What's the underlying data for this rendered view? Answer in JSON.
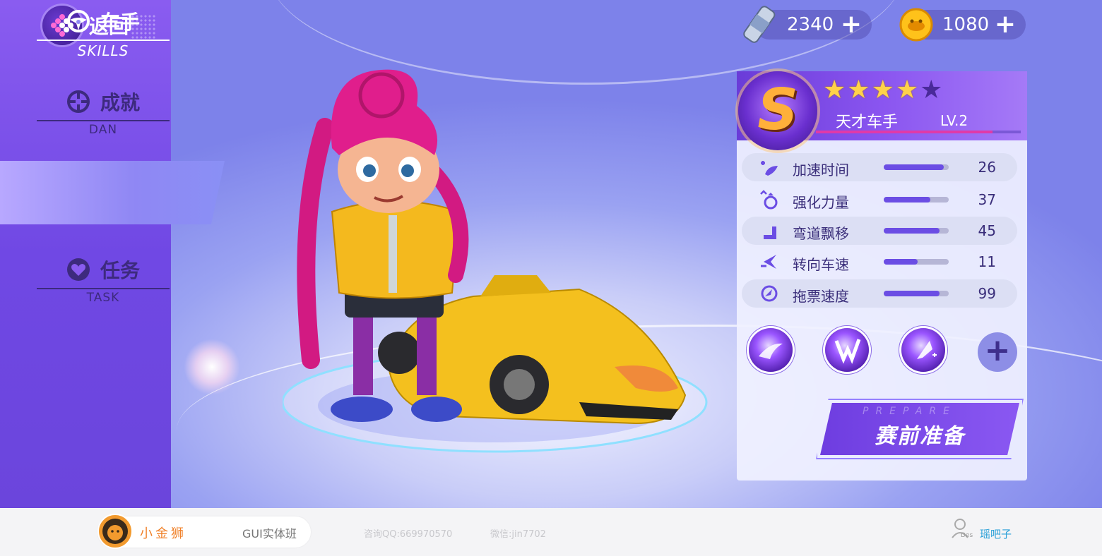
{
  "nav": {
    "back_label": "返回",
    "items": [
      {
        "label": "成就",
        "sub": "DAN"
      },
      {
        "label": "车手",
        "sub": "SKILLS",
        "active": true
      },
      {
        "label": "任务",
        "sub": "TASK"
      }
    ]
  },
  "currency": {
    "energy": "2340",
    "coins": "1080"
  },
  "driver": {
    "rank": "S",
    "stars_filled": 4,
    "stars_total": 5,
    "title": "天才车手",
    "level": "LV.2"
  },
  "stats": [
    {
      "label": "加速时间",
      "value": "26",
      "fill": 0.92,
      "icon": "accelerate-icon"
    },
    {
      "label": "强化力量",
      "value": "37",
      "fill": 0.72,
      "icon": "power-icon"
    },
    {
      "label": "弯道飘移",
      "value": "45",
      "fill": 0.86,
      "icon": "drift-icon"
    },
    {
      "label": "转向车速",
      "value": "11",
      "fill": 0.52,
      "icon": "steering-icon"
    },
    {
      "label": "拖票速度",
      "value": "99",
      "fill": 0.86,
      "icon": "speed-icon"
    }
  ],
  "skills": [
    "skill-wave-icon",
    "skill-lightning-icon",
    "skill-shield-icon"
  ],
  "prepare": {
    "en": "PREPARE",
    "cn": "赛前准备"
  },
  "footer": {
    "brand_name": "小金狮",
    "course": "GUI实体班",
    "qq": "咨询QQ:669970570",
    "wechat": "微信:jin7702",
    "des": "Des",
    "user": "瑶吧子"
  },
  "colors": {
    "sidebar": "#7048e4",
    "accent": "#6b4de4",
    "star": "#ffd24a",
    "brand": "#f0812a"
  }
}
